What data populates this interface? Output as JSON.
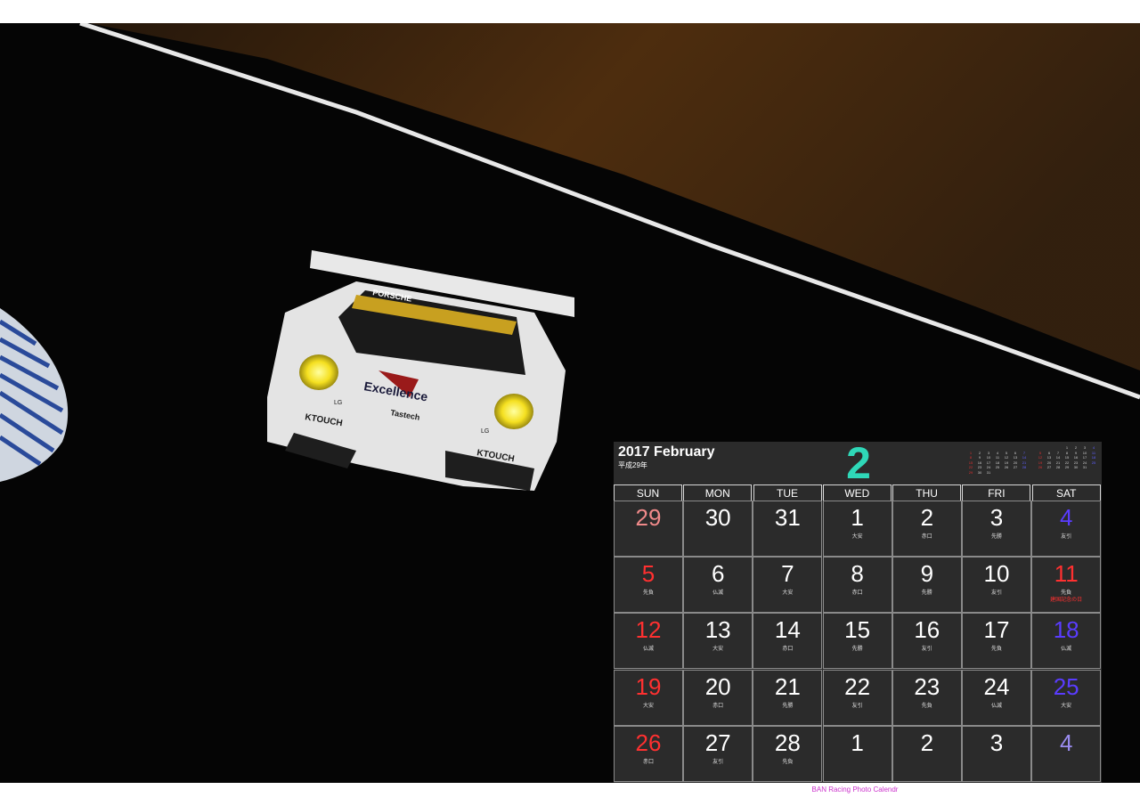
{
  "calendar": {
    "title": "2017 February",
    "era": "平成29年",
    "month_number": "2",
    "accent_color": "#2fd8b8",
    "weekdays": [
      "SUN",
      "MON",
      "TUE",
      "WED",
      "THU",
      "FRI",
      "SAT"
    ],
    "weeks": [
      [
        {
          "day": "29",
          "kind": "sun-prev",
          "rokuyo": ""
        },
        {
          "day": "30",
          "kind": "prev",
          "rokuyo": ""
        },
        {
          "day": "31",
          "kind": "prev",
          "rokuyo": ""
        },
        {
          "day": "1",
          "kind": "weekday",
          "rokuyo": "大安"
        },
        {
          "day": "2",
          "kind": "weekday",
          "rokuyo": "赤口"
        },
        {
          "day": "3",
          "kind": "weekday",
          "rokuyo": "先勝"
        },
        {
          "day": "4",
          "kind": "sat",
          "rokuyo": "友引"
        }
      ],
      [
        {
          "day": "5",
          "kind": "sun",
          "rokuyo": "先負"
        },
        {
          "day": "6",
          "kind": "weekday",
          "rokuyo": "仏滅"
        },
        {
          "day": "7",
          "kind": "weekday",
          "rokuyo": "大安"
        },
        {
          "day": "8",
          "kind": "weekday",
          "rokuyo": "赤口"
        },
        {
          "day": "9",
          "kind": "weekday",
          "rokuyo": "先勝"
        },
        {
          "day": "10",
          "kind": "weekday",
          "rokuyo": "友引"
        },
        {
          "day": "11",
          "kind": "holiday",
          "rokuyo": "先負",
          "holiday": "建国記念の日"
        }
      ],
      [
        {
          "day": "12",
          "kind": "sun",
          "rokuyo": "仏滅"
        },
        {
          "day": "13",
          "kind": "weekday",
          "rokuyo": "大安"
        },
        {
          "day": "14",
          "kind": "weekday",
          "rokuyo": "赤口"
        },
        {
          "day": "15",
          "kind": "weekday",
          "rokuyo": "先勝"
        },
        {
          "day": "16",
          "kind": "weekday",
          "rokuyo": "友引"
        },
        {
          "day": "17",
          "kind": "weekday",
          "rokuyo": "先負"
        },
        {
          "day": "18",
          "kind": "sat",
          "rokuyo": "仏滅"
        }
      ],
      [
        {
          "day": "19",
          "kind": "sun",
          "rokuyo": "大安"
        },
        {
          "day": "20",
          "kind": "weekday",
          "rokuyo": "赤口"
        },
        {
          "day": "21",
          "kind": "weekday",
          "rokuyo": "先勝"
        },
        {
          "day": "22",
          "kind": "weekday",
          "rokuyo": "友引"
        },
        {
          "day": "23",
          "kind": "weekday",
          "rokuyo": "先負"
        },
        {
          "day": "24",
          "kind": "weekday",
          "rokuyo": "仏滅"
        },
        {
          "day": "25",
          "kind": "sat",
          "rokuyo": "大安"
        }
      ],
      [
        {
          "day": "26",
          "kind": "sun",
          "rokuyo": "赤口"
        },
        {
          "day": "27",
          "kind": "weekday",
          "rokuyo": "友引"
        },
        {
          "day": "28",
          "kind": "weekday",
          "rokuyo": "先負"
        },
        {
          "day": "1",
          "kind": "next",
          "rokuyo": ""
        },
        {
          "day": "2",
          "kind": "next",
          "rokuyo": ""
        },
        {
          "day": "3",
          "kind": "next",
          "rokuyo": ""
        },
        {
          "day": "4",
          "kind": "sat-next",
          "rokuyo": ""
        }
      ]
    ],
    "mini_prev": {
      "rows": [
        [
          "",
          "",
          "",
          "",
          "",
          "",
          ""
        ],
        [
          "1",
          "2",
          "3",
          "4",
          "5",
          "6",
          "7"
        ],
        [
          "8",
          "9",
          "10",
          "11",
          "12",
          "13",
          "14"
        ],
        [
          "15",
          "16",
          "17",
          "18",
          "19",
          "20",
          "21"
        ],
        [
          "22",
          "23",
          "24",
          "25",
          "26",
          "27",
          "28"
        ],
        [
          "29",
          "30",
          "31",
          "",
          "",
          "",
          ""
        ]
      ]
    },
    "mini_next": {
      "rows": [
        [
          "",
          "",
          "",
          "1",
          "2",
          "3",
          "4"
        ],
        [
          "5",
          "6",
          "7",
          "8",
          "9",
          "10",
          "11"
        ],
        [
          "12",
          "13",
          "14",
          "15",
          "16",
          "17",
          "18"
        ],
        [
          "19",
          "20",
          "21",
          "22",
          "23",
          "24",
          "25"
        ],
        [
          "26",
          "27",
          "28",
          "29",
          "30",
          "31",
          ""
        ]
      ]
    },
    "colors": {
      "sunday": "#ff3030",
      "saturday": "#5a3cff",
      "prev_sunday": "#f08a8a",
      "next_saturday": "#9b8cf0",
      "weekday": "#ffffff"
    }
  },
  "photo": {
    "car_text": [
      "Excellence",
      "KTOUCH",
      "Tastech",
      "PORSCHE",
      "LG"
    ]
  },
  "footer": "BAN Racing Photo Calendr"
}
